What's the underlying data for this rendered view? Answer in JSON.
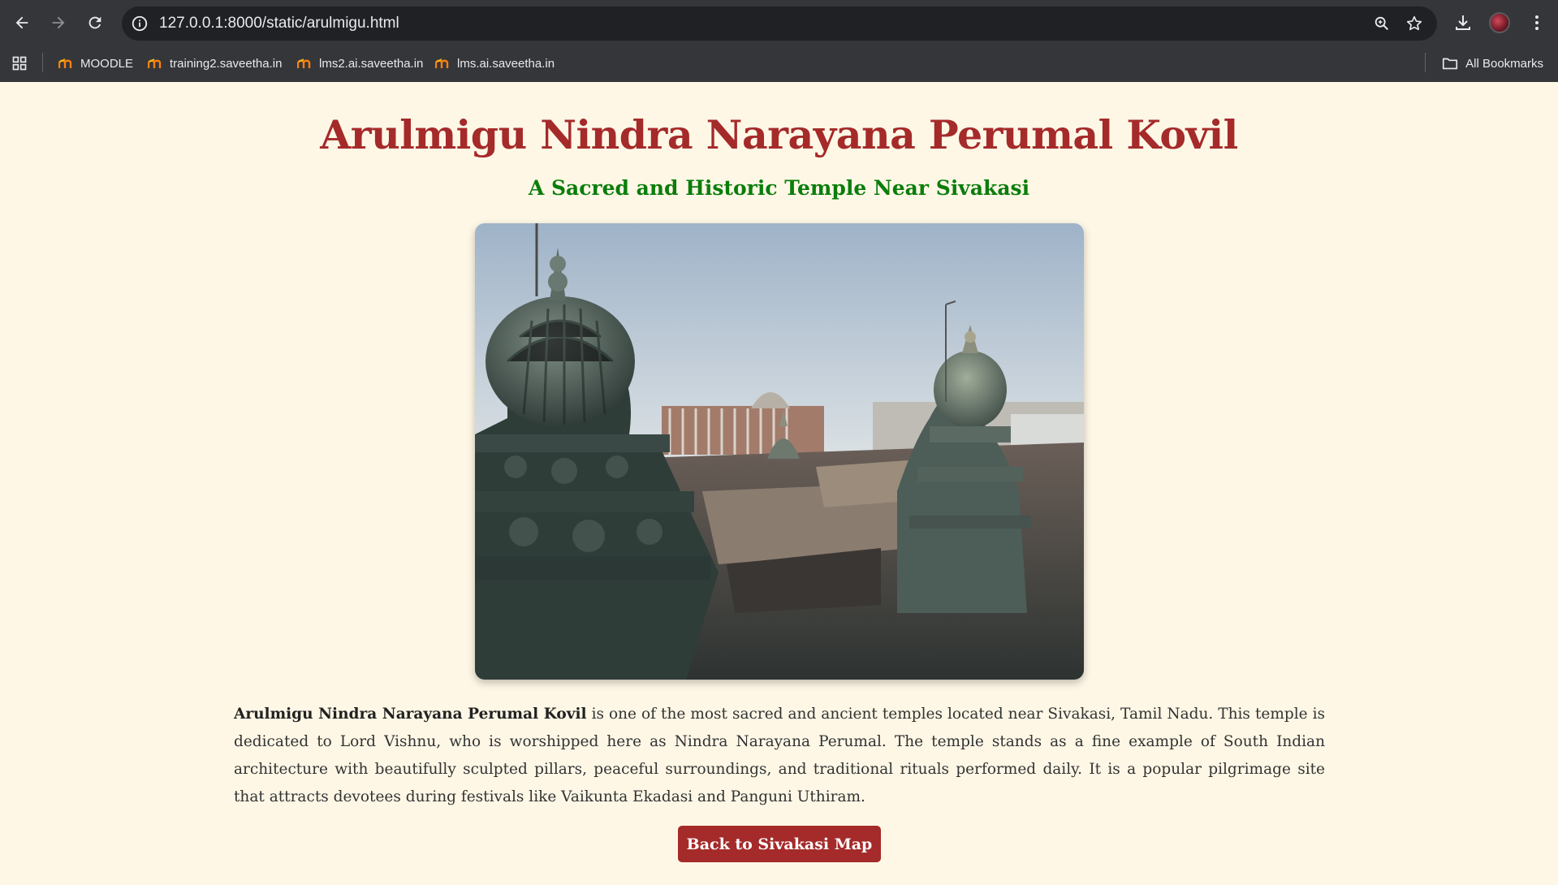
{
  "browser": {
    "url": "127.0.0.1:8000/static/arulmigu.html",
    "bookmarks": [
      {
        "label": "MOODLE",
        "icon": "moodle-icon"
      },
      {
        "label": "training2.saveetha.in",
        "icon": "moodle-icon"
      },
      {
        "label": "lms2.ai.saveetha.in",
        "icon": "moodle-icon"
      },
      {
        "label": "lms.ai.saveetha.in",
        "icon": "moodle-icon"
      }
    ],
    "all_bookmarks_label": "All Bookmarks"
  },
  "page": {
    "title": "Arulmigu Nindra Narayana Perumal Kovil",
    "subtitle": "A Sacred and Historic Temple Near Sivakasi",
    "description_bold": "Arulmigu Nindra Narayana Perumal Kovil",
    "description_rest": " is one of the most sacred and ancient temples located near Sivakasi, Tamil Nadu. This temple is dedicated to Lord Vishnu, who is worshipped here as Nindra Narayana Perumal. The temple stands as a fine example of South Indian architecture with beautifully sculpted pillars, peaceful surroundings, and traditional rituals performed daily. It is a popular pilgrimage site that attracts devotees during festivals like Vaikunta Ekadasi and Panguni Uthiram.",
    "back_button_label": "Back to Sivakasi Map"
  },
  "colors": {
    "background": "#fef7e6",
    "title": "#a52a2a",
    "subtitle": "#0b7d0b",
    "button": "#a52a2a"
  }
}
